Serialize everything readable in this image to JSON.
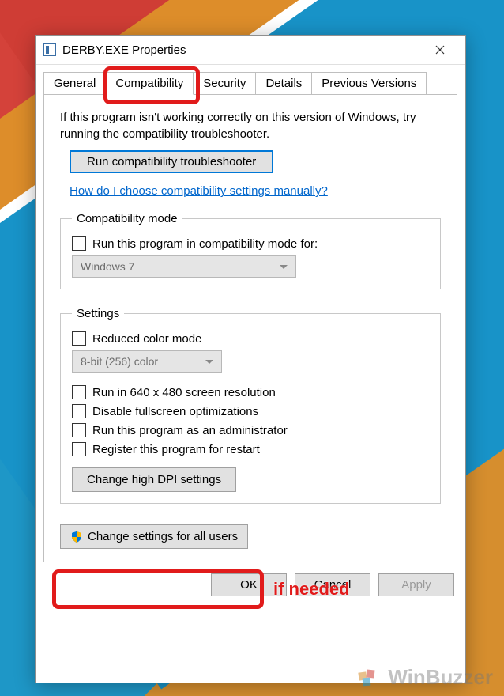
{
  "window": {
    "title": "DERBY.EXE Properties"
  },
  "tabs": {
    "general": "General",
    "compatibility": "Compatibility",
    "security": "Security",
    "details": "Details",
    "previous": "Previous Versions"
  },
  "intro": "If this program isn't working correctly on this version of Windows, try running the compatibility troubleshooter.",
  "buttons": {
    "troubleshoot": "Run compatibility troubleshooter",
    "help_link": "How do I choose compatibility settings manually?",
    "dpi": "Change high DPI settings",
    "all_users": "Change settings for all users",
    "ok": "OK",
    "cancel": "Cancel",
    "apply": "Apply"
  },
  "groups": {
    "compat_mode": {
      "legend": "Compatibility mode",
      "check_label": "Run this program in compatibility mode for:",
      "select_value": "Windows 7"
    },
    "settings": {
      "legend": "Settings",
      "reduced_color": "Reduced color mode",
      "color_select": "8-bit (256) color",
      "run_640": "Run in 640 x 480 screen resolution",
      "disable_fullscreen": "Disable fullscreen optimizations",
      "run_admin": "Run this program as an administrator",
      "register_restart": "Register this program for restart"
    }
  },
  "annotations": {
    "if_needed": "if needed"
  },
  "watermark": "WinBuzzer"
}
